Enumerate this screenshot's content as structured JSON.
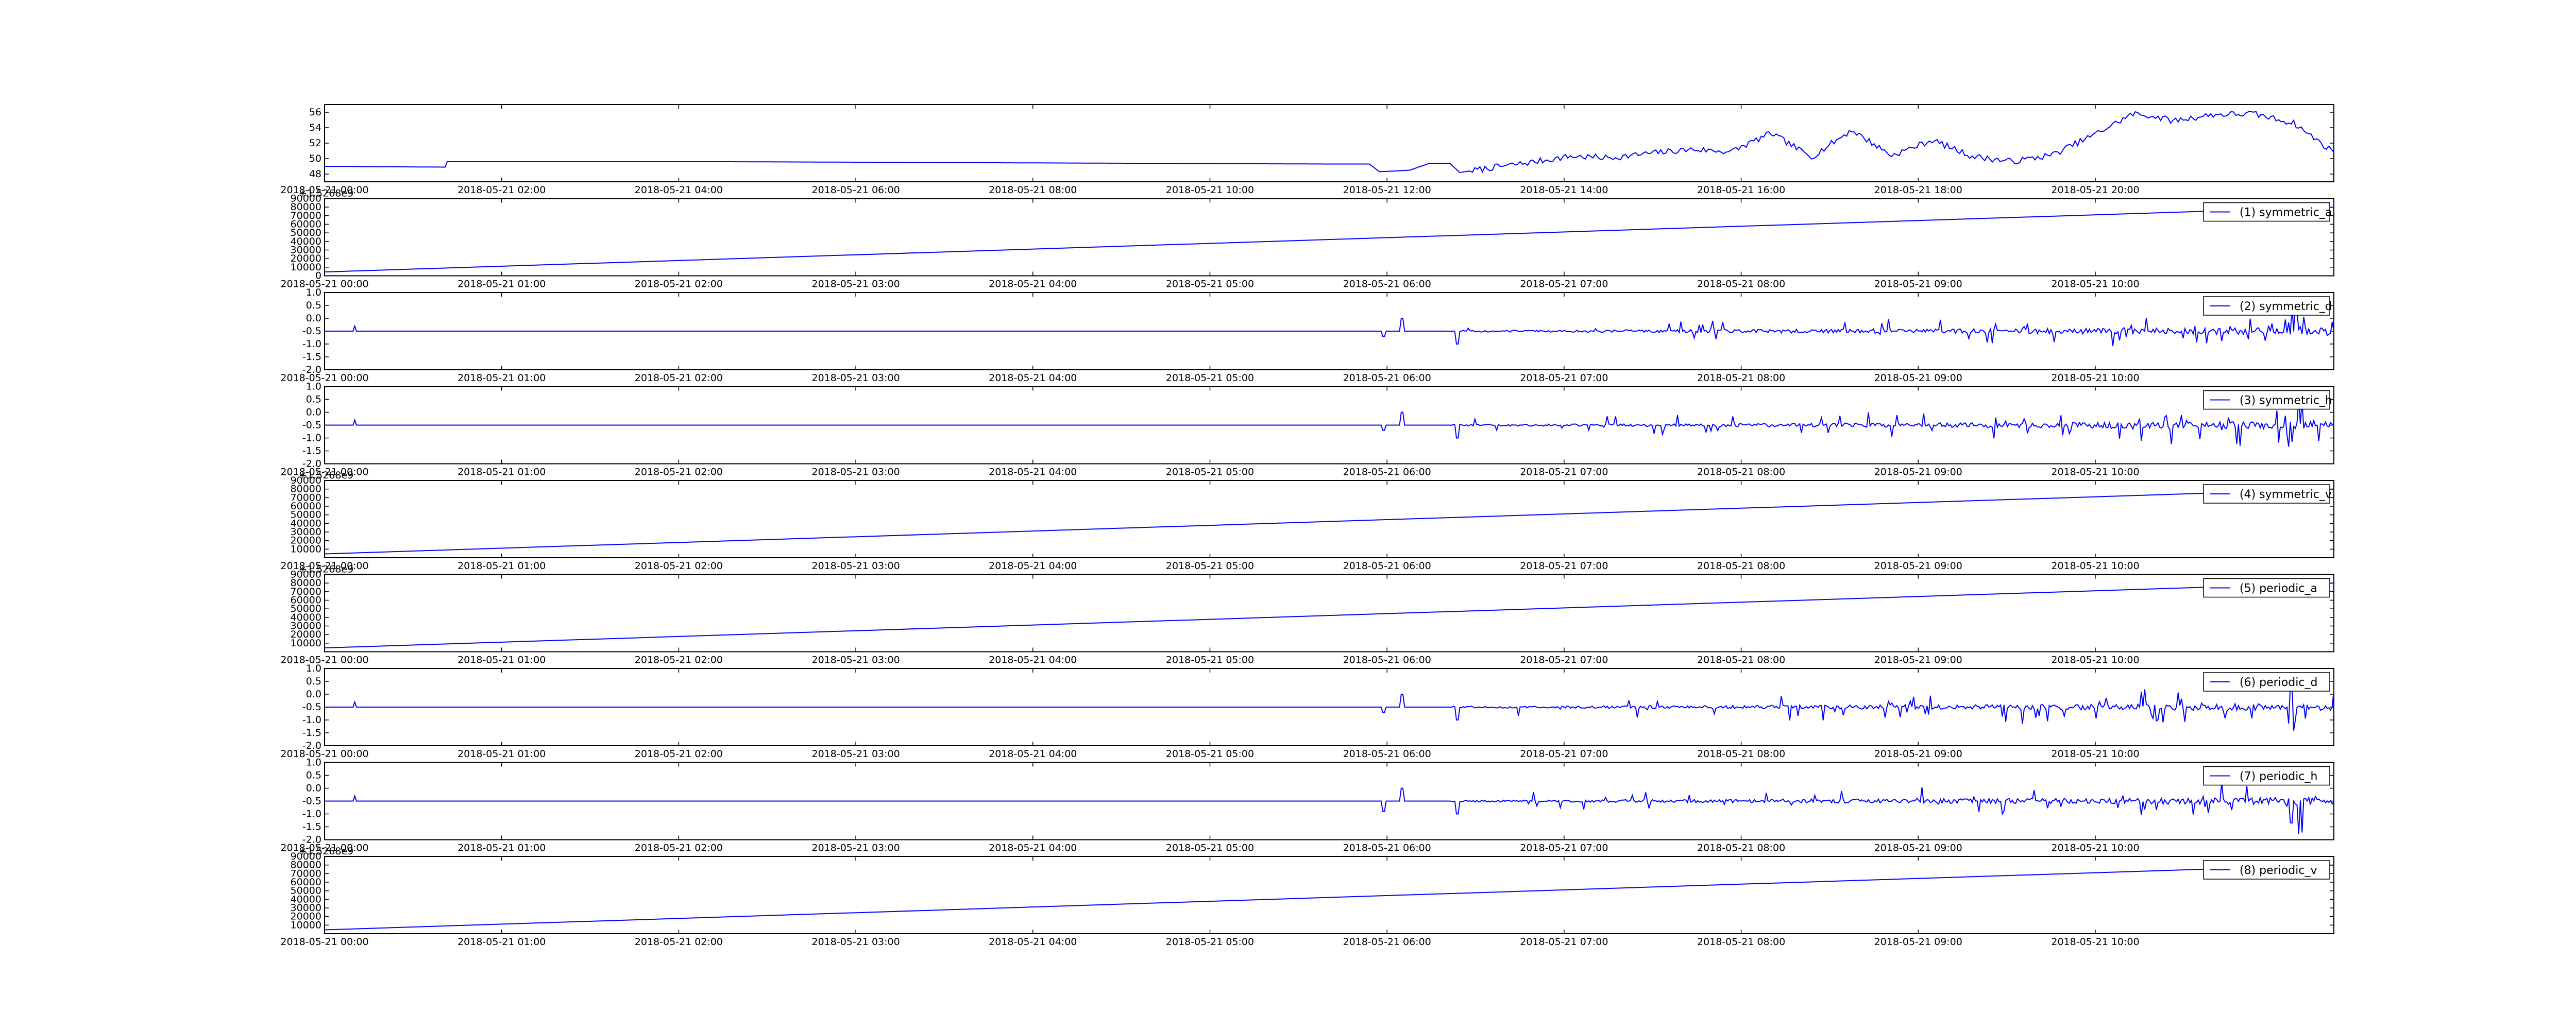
{
  "figure": {
    "background": "#ffffff",
    "line_color": "#0000ff"
  },
  "chart_data": [
    {
      "type": "line",
      "name_in_legend": "",
      "x_ticks": [
        "2018-05-21 00:00",
        "2018-05-21 02:00",
        "2018-05-21 04:00",
        "2018-05-21 06:00",
        "2018-05-21 08:00",
        "2018-05-21 10:00",
        "2018-05-21 12:00",
        "2018-05-21 14:00",
        "2018-05-21 16:00",
        "2018-05-21 18:00",
        "2018-05-21 20:00"
      ],
      "ylim": [
        47,
        57
      ],
      "y_ticks": [
        48,
        50,
        52,
        54,
        56
      ],
      "y_offset_label": "",
      "series": [
        {
          "x": [
            0,
            0.06,
            0.061,
            0.1,
            0.2,
            0.3,
            0.4,
            0.5,
            0.52,
            0.525,
            0.54,
            0.55,
            0.56,
            0.565,
            0.58,
            0.6,
            0.62,
            0.64,
            0.66,
            0.68,
            0.7,
            0.72,
            0.74,
            0.76,
            0.78,
            0.8,
            0.82,
            0.84,
            0.86,
            0.88,
            0.9,
            0.91,
            0.92,
            0.94,
            0.96,
            0.97,
            0.98,
            1.0
          ],
          "y": [
            49,
            48.9,
            49.6,
            49.6,
            49.6,
            49.5,
            49.4,
            49.3,
            49.3,
            48.3,
            48.5,
            49.4,
            49.4,
            48.2,
            48.8,
            49.5,
            50.3,
            50.1,
            50.7,
            51.2,
            50.9,
            53.3,
            50.2,
            53.7,
            50.4,
            52.4,
            50.3,
            49.6,
            50.5,
            53.0,
            55.8,
            55.5,
            54.9,
            55.7,
            55.8,
            55.2,
            54.6,
            50.8
          ]
        }
      ]
    },
    {
      "type": "line",
      "legend": "(1) symmetric_a",
      "x_ticks": [
        "2018-05-21 00:00",
        "2018-05-21 01:00",
        "2018-05-21 02:00",
        "2018-05-21 03:00",
        "2018-05-21 04:00",
        "2018-05-21 05:00",
        "2018-05-21 06:00",
        "2018-05-21 07:00",
        "2018-05-21 08:00",
        "2018-05-21 09:00",
        "2018-05-21 10:00"
      ],
      "ylim": [
        0,
        90000
      ],
      "y_ticks": [
        0,
        10000,
        20000,
        30000,
        40000,
        50000,
        60000,
        70000,
        80000,
        90000
      ],
      "y_offset_label": "+1.5268e9",
      "series": [
        {
          "x": [
            0,
            1
          ],
          "y": [
            4500,
            80000
          ]
        }
      ]
    },
    {
      "type": "line",
      "legend": "(2) symmetric_d",
      "x_ticks": [
        "2018-05-21 00:00",
        "2018-05-21 01:00",
        "2018-05-21 02:00",
        "2018-05-21 03:00",
        "2018-05-21 04:00",
        "2018-05-21 05:00",
        "2018-05-21 06:00",
        "2018-05-21 07:00",
        "2018-05-21 08:00",
        "2018-05-21 09:00",
        "2018-05-21 10:00"
      ],
      "ylim": [
        -2.0,
        1.0
      ],
      "y_ticks": [
        -2.0,
        -1.5,
        -1.0,
        -0.5,
        0.0,
        0.5,
        1.0
      ],
      "y_offset_label": "",
      "baseline": -0.5,
      "series": [
        {
          "x": [
            0,
            1
          ],
          "y": [
            -0.5,
            -0.5
          ]
        }
      ]
    },
    {
      "type": "line",
      "legend": "(3) symmetric_h",
      "x_ticks": [
        "2018-05-21 00:00",
        "2018-05-21 01:00",
        "2018-05-21 02:00",
        "2018-05-21 03:00",
        "2018-05-21 04:00",
        "2018-05-21 05:00",
        "2018-05-21 06:00",
        "2018-05-21 07:00",
        "2018-05-21 08:00",
        "2018-05-21 09:00",
        "2018-05-21 10:00"
      ],
      "ylim": [
        -2.0,
        1.0
      ],
      "y_ticks": [
        -2.0,
        -1.5,
        -1.0,
        -0.5,
        0.0,
        0.5,
        1.0
      ],
      "y_offset_label": "",
      "baseline": -0.5,
      "series": [
        {
          "x": [
            0,
            1
          ],
          "y": [
            -0.5,
            -0.5
          ]
        }
      ]
    },
    {
      "type": "line",
      "legend": "(4) symmetric_v",
      "x_ticks": [
        "2018-05-21 00:00",
        "2018-05-21 01:00",
        "2018-05-21 02:00",
        "2018-05-21 03:00",
        "2018-05-21 04:00",
        "2018-05-21 05:00",
        "2018-05-21 06:00",
        "2018-05-21 07:00",
        "2018-05-21 08:00",
        "2018-05-21 09:00",
        "2018-05-21 10:00"
      ],
      "ylim": [
        0,
        90000
      ],
      "y_ticks": [
        10000,
        20000,
        30000,
        40000,
        50000,
        60000,
        70000,
        80000,
        90000
      ],
      "y_offset_label": "+1.5268e9",
      "series": [
        {
          "x": [
            0,
            1
          ],
          "y": [
            4500,
            80000
          ]
        }
      ]
    },
    {
      "type": "line",
      "legend": "(5) periodic_a",
      "x_ticks": [
        "2018-05-21 00:00",
        "2018-05-21 01:00",
        "2018-05-21 02:00",
        "2018-05-21 03:00",
        "2018-05-21 04:00",
        "2018-05-21 05:00",
        "2018-05-21 06:00",
        "2018-05-21 07:00",
        "2018-05-21 08:00",
        "2018-05-21 09:00",
        "2018-05-21 10:00"
      ],
      "ylim": [
        0,
        90000
      ],
      "y_ticks": [
        10000,
        20000,
        30000,
        40000,
        50000,
        60000,
        70000,
        80000,
        90000
      ],
      "y_offset_label": "+1.5268e9",
      "series": [
        {
          "x": [
            0,
            1
          ],
          "y": [
            4500,
            80000
          ]
        }
      ]
    },
    {
      "type": "line",
      "legend": "(6) periodic_d",
      "x_ticks": [
        "2018-05-21 00:00",
        "2018-05-21 01:00",
        "2018-05-21 02:00",
        "2018-05-21 03:00",
        "2018-05-21 04:00",
        "2018-05-21 05:00",
        "2018-05-21 06:00",
        "2018-05-21 07:00",
        "2018-05-21 08:00",
        "2018-05-21 09:00",
        "2018-05-21 10:00"
      ],
      "ylim": [
        -2.0,
        1.0
      ],
      "y_ticks": [
        -2.0,
        -1.5,
        -1.0,
        -0.5,
        0.0,
        0.5,
        1.0
      ],
      "y_offset_label": "",
      "baseline": -0.5,
      "series": [
        {
          "x": [
            0,
            1
          ],
          "y": [
            -0.5,
            -0.5
          ]
        }
      ]
    },
    {
      "type": "line",
      "legend": "(7) periodic_h",
      "x_ticks": [
        "2018-05-21 00:00",
        "2018-05-21 01:00",
        "2018-05-21 02:00",
        "2018-05-21 03:00",
        "2018-05-21 04:00",
        "2018-05-21 05:00",
        "2018-05-21 06:00",
        "2018-05-21 07:00",
        "2018-05-21 08:00",
        "2018-05-21 09:00",
        "2018-05-21 10:00"
      ],
      "ylim": [
        -2.0,
        1.0
      ],
      "y_ticks": [
        -2.0,
        -1.5,
        -1.0,
        -0.5,
        0.0,
        0.5,
        1.0
      ],
      "y_offset_label": "",
      "baseline": -0.5,
      "series": [
        {
          "x": [
            0,
            1
          ],
          "y": [
            -0.5,
            -0.5
          ]
        }
      ]
    },
    {
      "type": "line",
      "legend": "(8) periodic_v",
      "x_ticks": [
        "2018-05-21 00:00",
        "2018-05-21 01:00",
        "2018-05-21 02:00",
        "2018-05-21 03:00",
        "2018-05-21 04:00",
        "2018-05-21 05:00",
        "2018-05-21 06:00",
        "2018-05-21 07:00",
        "2018-05-21 08:00",
        "2018-05-21 09:00",
        "2018-05-21 10:00"
      ],
      "ylim": [
        0,
        90000
      ],
      "y_ticks": [
        10000,
        20000,
        30000,
        40000,
        50000,
        60000,
        70000,
        80000,
        90000
      ],
      "y_offset_label": "+1.5268e9",
      "series": [
        {
          "x": [
            0,
            1
          ],
          "y": [
            4500,
            80000
          ]
        }
      ]
    }
  ]
}
